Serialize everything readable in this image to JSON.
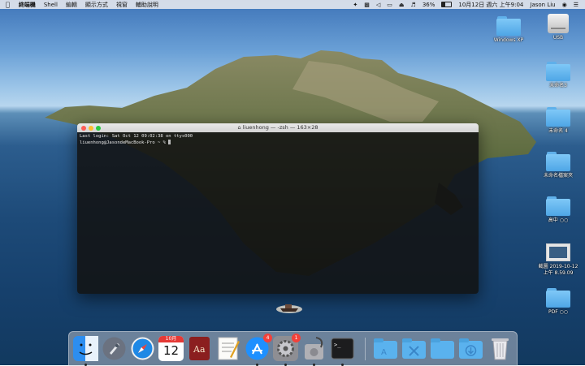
{
  "menubar": {
    "app_name": "終端機",
    "menus": [
      "Shell",
      "編輯",
      "顯示方式",
      "視窗",
      "輔助說明"
    ],
    "battery_percent": "36%",
    "datetime": "10月12日 週六 上午9:04",
    "user": "Jason Liu"
  },
  "desktop_icons": [
    {
      "label": "Windows XP",
      "icon": "folder-icon"
    },
    {
      "label": "USB",
      "icon": "drive-icon"
    },
    {
      "label": "未命名3",
      "icon": "folder-icon"
    },
    {
      "label": "未命名 4",
      "icon": "folder-icon"
    },
    {
      "label": "未命名檔案夾",
      "icon": "folder-icon"
    },
    {
      "label": "高中 ○○",
      "icon": "folder-icon"
    },
    {
      "label": "截圖 2019-10-12 上午 8.59.09",
      "icon": "screenshot-icon"
    },
    {
      "label": "PDF ○○",
      "icon": "folder-icon"
    }
  ],
  "terminal": {
    "title": "liuenhong — -zsh — 163×28",
    "line1": "Last login: Sat Oct 12 09:02:38 on ttys000",
    "prompt": "liuenhong@JasondeMacBook-Pro ~ % "
  },
  "dock": {
    "calendar_month": "10月",
    "calendar_day": "12",
    "appstore_badge": "4",
    "preferences_badge": "1"
  },
  "colors": {
    "accent_folder": "#4ea6e6",
    "badge": "#f2413a"
  }
}
